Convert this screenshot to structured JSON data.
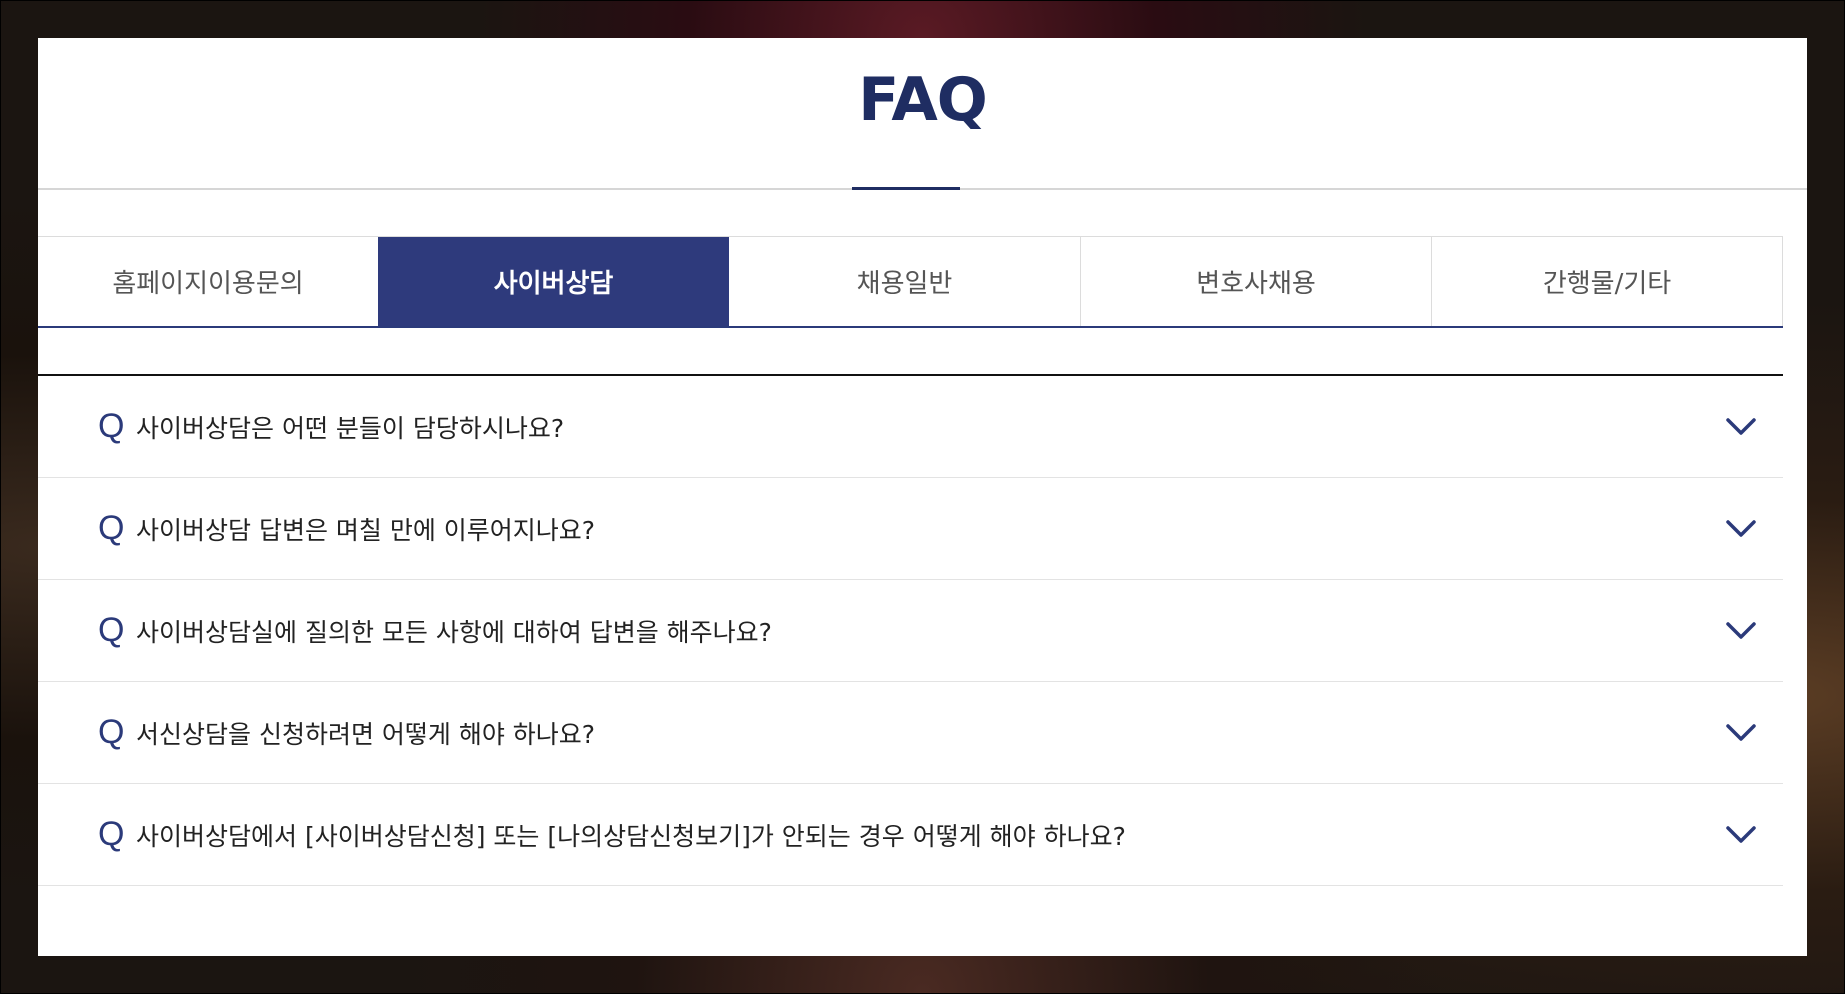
{
  "page": {
    "title": "FAQ"
  },
  "tabs": [
    {
      "label": "홈페이지이용문의",
      "active": false
    },
    {
      "label": "사이버상담",
      "active": true
    },
    {
      "label": "채용일반",
      "active": false
    },
    {
      "label": "변호사채용",
      "active": false
    },
    {
      "label": "간행물/기타",
      "active": false
    }
  ],
  "faq": {
    "q_marker": "Q",
    "items": [
      {
        "question": "사이버상담은 어떤 분들이 담당하시나요?"
      },
      {
        "question": "사이버상담 답변은 며칠 만에 이루어지나요?"
      },
      {
        "question": "사이버상담실에 질의한 모든 사항에 대하여 답변을 해주나요?"
      },
      {
        "question": "서신상담을 신청하려면 어떻게 해야 하나요?"
      },
      {
        "question": "사이버상담에서 [사이버상담신청] 또는 [나의상담신청보기]가 안되는 경우 어떻게 해야 하나요?"
      }
    ],
    "expand_icon": "chevron-down-icon"
  },
  "colors": {
    "accent": "#2e3a7c",
    "title": "#1f2d62"
  }
}
